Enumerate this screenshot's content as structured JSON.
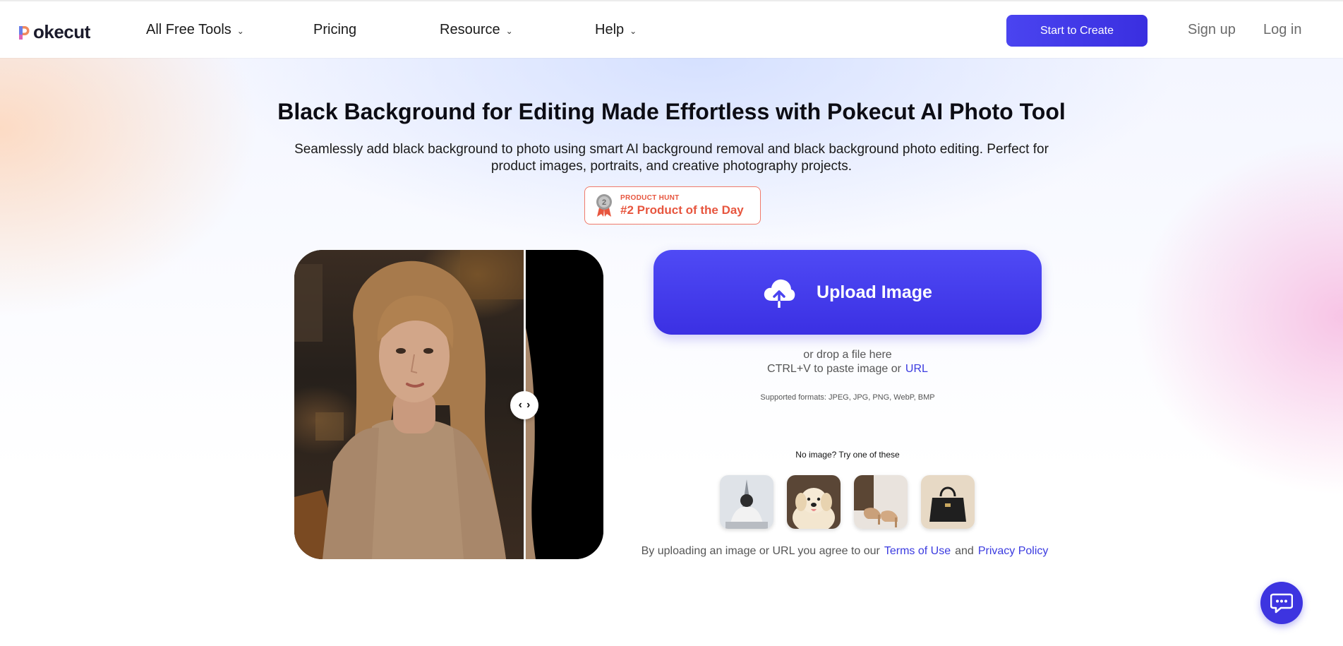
{
  "brand": {
    "name": "Pokecut",
    "name_rest": "okecut",
    "accent": "#3d34e0"
  },
  "nav": {
    "items": [
      {
        "label": "All Free Tools",
        "has_dropdown": true
      },
      {
        "label": "Pricing",
        "has_dropdown": false
      },
      {
        "label": "Resource",
        "has_dropdown": true
      },
      {
        "label": "Help",
        "has_dropdown": true
      }
    ],
    "cta": "Start to Create",
    "signup": "Sign up",
    "login": "Log in"
  },
  "hero": {
    "title": "Black Background for Editing Made Effortless with Pokecut AI Photo Tool",
    "subtitle": "Seamlessly add black background to photo using smart AI background removal and black background photo editing. Perfect for product images, portraits, and creative photography projects."
  },
  "badge": {
    "small": "PRODUCT HUNT",
    "big": "#2 Product of the Day",
    "rank": "2",
    "color": "#e7563f"
  },
  "upload": {
    "label": "Upload Image",
    "drop_hint": "or drop a file here",
    "paste_hint": "CTRL+V to paste image or",
    "url_label": "URL",
    "formats": "Supported formats: JPEG, JPG, PNG, WebP, BMP"
  },
  "samples": {
    "title": "No image? Try one of these",
    "items": [
      {
        "icon": "person-eiffel-tower-image"
      },
      {
        "icon": "golden-retriever-image"
      },
      {
        "icon": "beige-heels-image"
      },
      {
        "icon": "black-handbag-image"
      }
    ]
  },
  "agreement": {
    "prefix": "By uploading an image or URL you agree to our",
    "terms": "Terms of Use",
    "and": "and",
    "privacy": "Privacy Policy"
  },
  "chat": {
    "icon": "chat-bubble-icon"
  }
}
